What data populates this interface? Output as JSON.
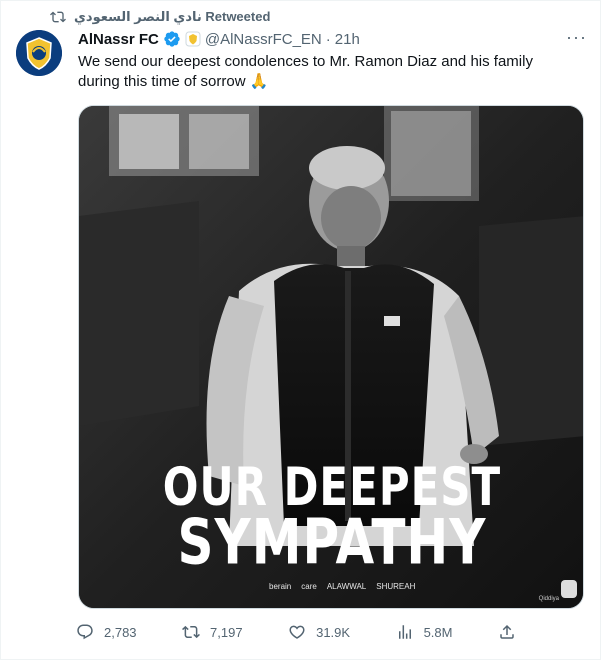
{
  "retweet": {
    "label": "نادي النصر السعودي Retweeted",
    "icon": "retweet-icon"
  },
  "author": {
    "name": "AlNassr FC",
    "handle": "@AlNassrFC_EN",
    "separator": "·",
    "time": "21h",
    "verified_icon": "verified-badge-icon",
    "affiliate_icon": "affiliate-badge-icon"
  },
  "tweet": {
    "text": "We send our deepest condolences to Mr. Ramon Diaz and his family during this time of sorrow 🙏"
  },
  "media": {
    "line1": "OUR DEEPEST",
    "line2": "SYMPATHY",
    "sponsors": [
      "berain",
      "care",
      "ALAWWAL",
      "SHUREAH"
    ],
    "club_mark": "Qiddiya"
  },
  "actions": {
    "reply_count": "2,783",
    "retweet_count": "7,197",
    "like_count": "31.9K",
    "views_count": "5.8M"
  },
  "colors": {
    "accent": "#1d9bf0",
    "secondary_text": "#536471",
    "text": "#0f1419",
    "gold": "#f2c230"
  }
}
